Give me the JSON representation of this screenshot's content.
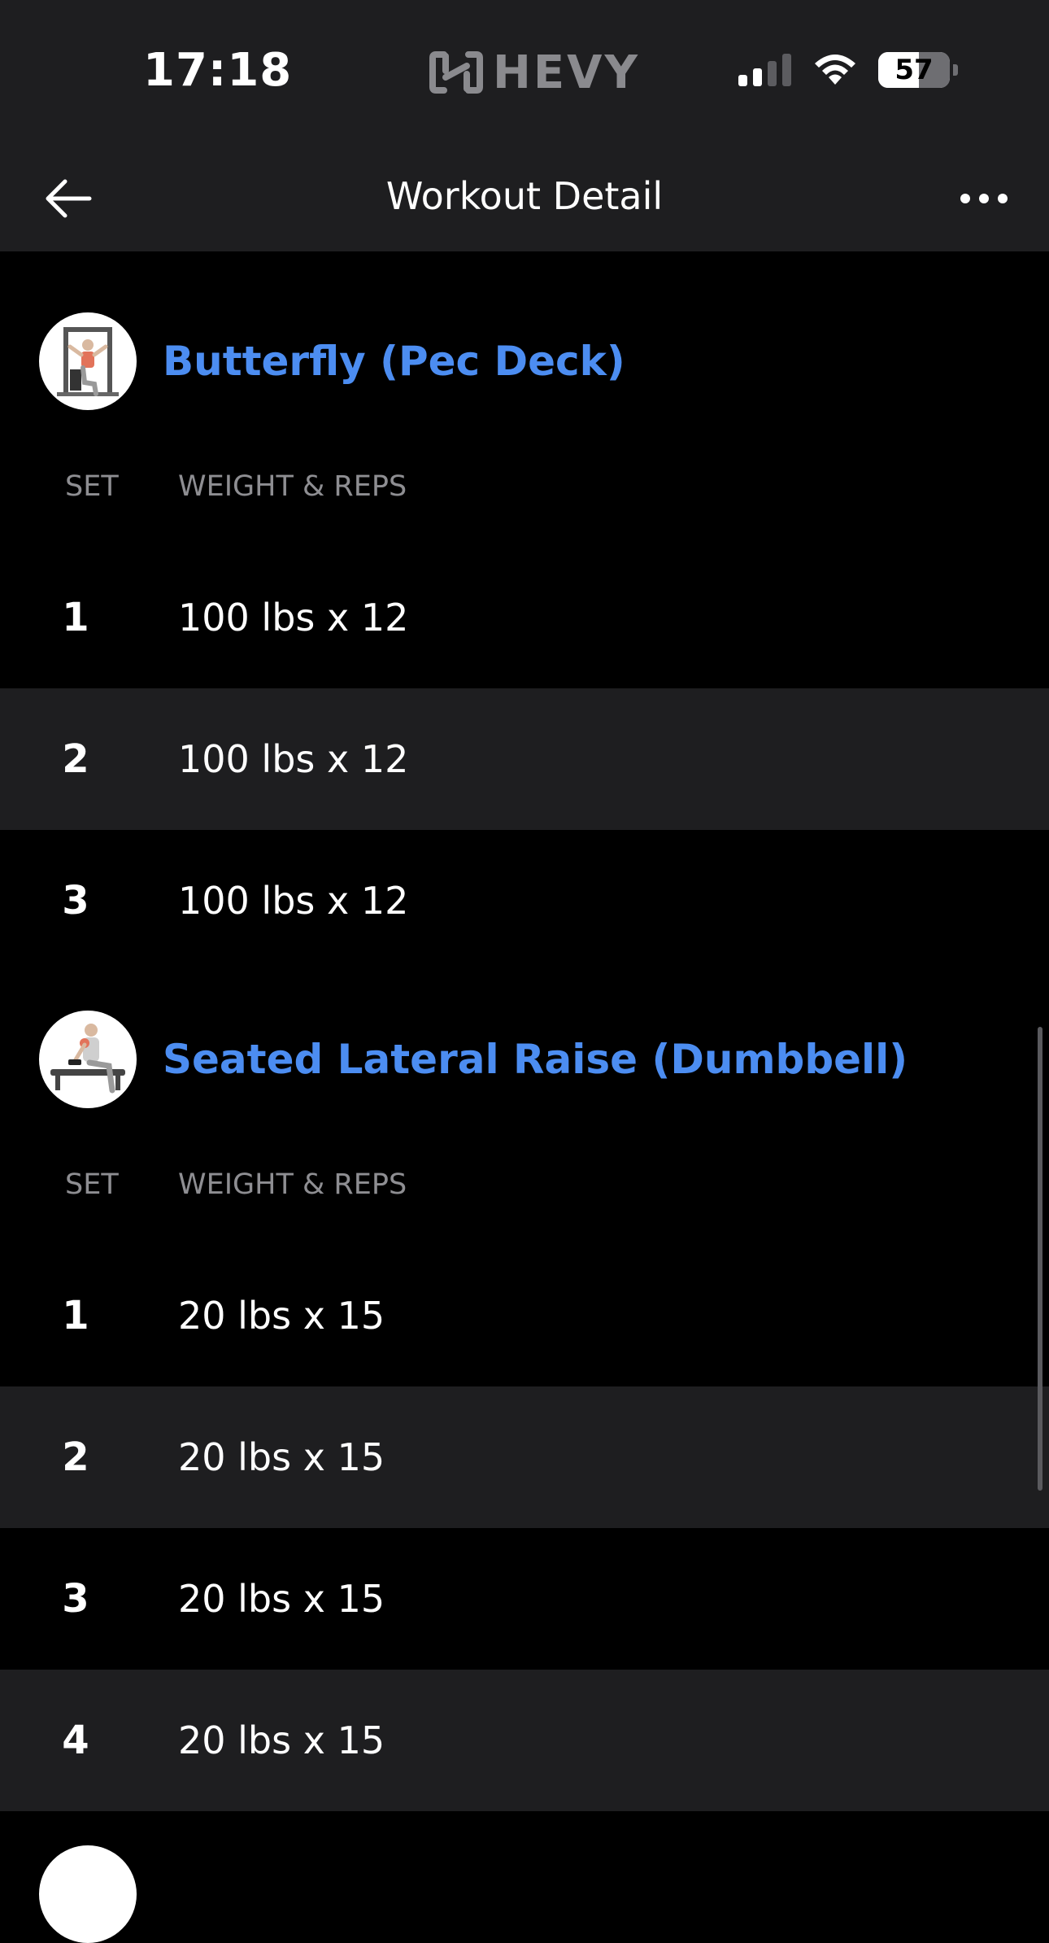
{
  "status_bar": {
    "time": "17:18",
    "brand": "HEVY",
    "battery": "57",
    "battery_level": 0.57
  },
  "nav": {
    "title": "Workout Detail"
  },
  "columns": {
    "set": "SET",
    "weight_reps": "WEIGHT & REPS"
  },
  "exercises": [
    {
      "name": "Butterfly (Pec Deck)",
      "sets": [
        {
          "num": "1",
          "value": "100 lbs x 12"
        },
        {
          "num": "2",
          "value": "100 lbs x 12"
        },
        {
          "num": "3",
          "value": "100 lbs x 12"
        }
      ]
    },
    {
      "name": "Seated Lateral Raise (Dumbbell)",
      "sets": [
        {
          "num": "1",
          "value": "20 lbs x 15"
        },
        {
          "num": "2",
          "value": "20 lbs x 15"
        },
        {
          "num": "3",
          "value": "20 lbs x 15"
        },
        {
          "num": "4",
          "value": "20 lbs x 15"
        }
      ]
    }
  ],
  "colors": {
    "accent": "#4c8df1",
    "background": "#000000",
    "surface": "#1e1e20",
    "muted_text": "#8e8e92"
  }
}
